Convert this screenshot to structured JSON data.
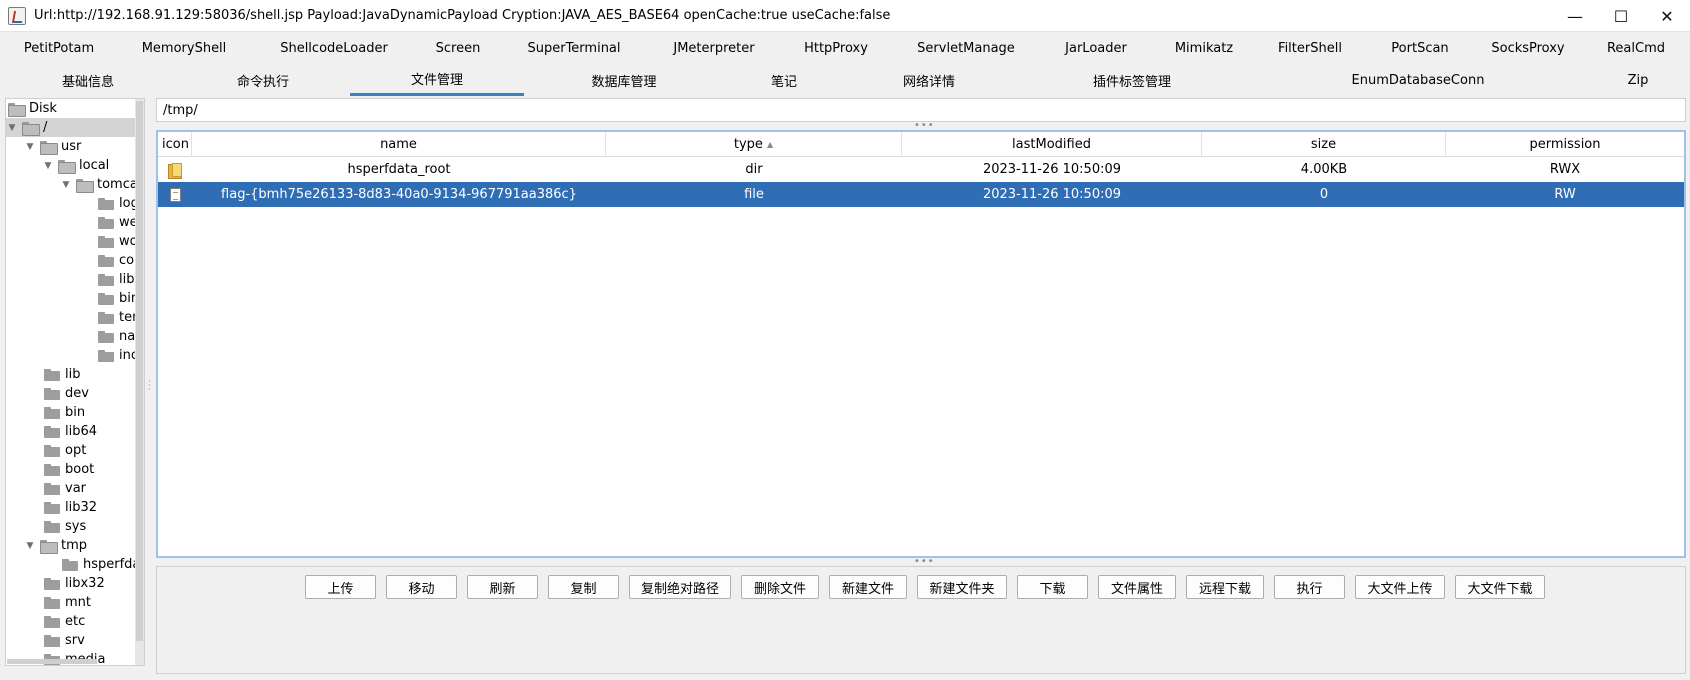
{
  "window": {
    "title": "Url:http://192.168.91.129:58036/shell.jsp Payload:JavaDynamicPayload Cryption:JAVA_AES_BASE64 openCache:true useCache:false",
    "minimize": "—",
    "maximize": "☐",
    "close": "✕"
  },
  "tabs_row1": [
    "PetitPotam",
    "MemoryShell",
    "ShellcodeLoader",
    "Screen",
    "SuperTerminal",
    "JMeterpreter",
    "HttpProxy",
    "ServletManage",
    "JarLoader",
    "Mimikatz",
    "FilterShell",
    "PortScan",
    "SocksProxy",
    "RealCmd"
  ],
  "tabs_row2": [
    "基础信息",
    "命令执行",
    "文件管理",
    "数据库管理",
    "笔记",
    "网络详情",
    "插件标签管理",
    "EnumDatabaseConn",
    "Zip"
  ],
  "active_tab": "文件管理",
  "tree": {
    "items": [
      {
        "label": "Disk",
        "expander": ""
      },
      {
        "label": "/",
        "expander": "▼"
      },
      {
        "label": "usr",
        "expander": "▼"
      },
      {
        "label": "local",
        "expander": "▼"
      },
      {
        "label": "tomcat",
        "expander": "▼"
      },
      {
        "label": "logs",
        "expander": ""
      },
      {
        "label": "webapps",
        "expander": ""
      },
      {
        "label": "work",
        "expander": ""
      },
      {
        "label": "conf",
        "expander": ""
      },
      {
        "label": "lib",
        "expander": ""
      },
      {
        "label": "bin",
        "expander": ""
      },
      {
        "label": "temp",
        "expander": ""
      },
      {
        "label": "native-jni-lib",
        "expander": ""
      },
      {
        "label": "include",
        "expander": ""
      },
      {
        "label": "lib",
        "expander": ""
      },
      {
        "label": "dev",
        "expander": ""
      },
      {
        "label": "bin",
        "expander": ""
      },
      {
        "label": "lib64",
        "expander": ""
      },
      {
        "label": "opt",
        "expander": ""
      },
      {
        "label": "boot",
        "expander": ""
      },
      {
        "label": "var",
        "expander": ""
      },
      {
        "label": "lib32",
        "expander": ""
      },
      {
        "label": "sys",
        "expander": ""
      },
      {
        "label": "tmp",
        "expander": "▼"
      },
      {
        "label": "hsperfdata_root",
        "expander": ""
      },
      {
        "label": "libx32",
        "expander": ""
      },
      {
        "label": "mnt",
        "expander": ""
      },
      {
        "label": "etc",
        "expander": ""
      },
      {
        "label": "srv",
        "expander": ""
      },
      {
        "label": "media",
        "expander": ""
      }
    ]
  },
  "path": "/tmp/",
  "table": {
    "columns": [
      "icon",
      "name",
      "type",
      "lastModified",
      "size",
      "permission"
    ],
    "sorted_column": "type",
    "rows": [
      {
        "icon": "folder-icon",
        "name": "hsperfdata_root",
        "type": "dir",
        "lastModified": "2023-11-26 10:50:09",
        "size": "4.00KB",
        "permission": "RWX"
      },
      {
        "icon": "file-icon",
        "name": "flag-{bmh75e26133-8d83-40a0-9134-967791aa386c}",
        "type": "file",
        "lastModified": "2023-11-26 10:50:09",
        "size": "0",
        "permission": "RW"
      }
    ]
  },
  "buttons": [
    "上传",
    "移动",
    "刷新",
    "复制",
    "复制绝对路径",
    "删除文件",
    "新建文件",
    "新建文件夹",
    "下载",
    "文件属性",
    "远程下载",
    "执行",
    "大文件上传",
    "大文件下载"
  ],
  "colors": {
    "selection": "#2f6eb5",
    "tab_underline": "#3b82c4",
    "table_border": "#9ec3e8"
  }
}
